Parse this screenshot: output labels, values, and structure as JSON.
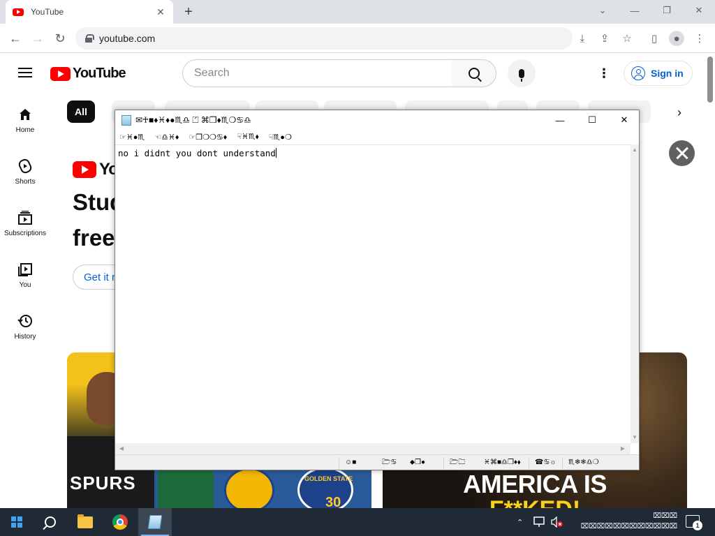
{
  "browser": {
    "tab_title": "YouTube",
    "tab_close": "✕",
    "new_tab": "+",
    "url": "youtube.com",
    "window_controls": [
      "⌄",
      "—",
      "❐",
      "✕"
    ]
  },
  "youtube": {
    "logo_text": "YouTube",
    "search_placeholder": "Search",
    "sign_in": "Sign in",
    "guide": [
      {
        "label": "Home",
        "icon": "home-icon"
      },
      {
        "label": "Shorts",
        "icon": "shorts-icon"
      },
      {
        "label": "Subscriptions",
        "icon": "subscriptions-icon"
      },
      {
        "label": "You",
        "icon": "you-icon"
      },
      {
        "label": "History",
        "icon": "history-icon"
      }
    ],
    "chips": [
      {
        "label": "All",
        "active": true
      },
      {
        "label": ""
      },
      {
        "label": ""
      },
      {
        "label": ""
      },
      {
        "label": ""
      },
      {
        "label": ""
      },
      {
        "label": ""
      },
      {
        "label": ""
      },
      {
        "label": ""
      }
    ],
    "promo": {
      "logo_text": "Yo",
      "line1": "Stud",
      "line2": "free",
      "button": "Get it n"
    },
    "thumb1": {
      "team_text": "SPURS",
      "badge_text": "GOLDEN STATE",
      "badge_number": "30"
    },
    "thumb2": {
      "headline": "AMERICA IS",
      "headline2": "F**KED!"
    }
  },
  "notepad": {
    "title": "✉♰■♦♓♦●♏♎  ⏍  ⌘❒♦♏❍♋♎",
    "menu": [
      "☞♓●♏",
      "☜♎♓♦",
      "☞❒❍❍♋♦",
      "☟♓♏⬧",
      "☟♏●❍"
    ],
    "content": "no i didnt you dont understand",
    "status": [
      "☺■",
      "🗁♋",
      "⬥❒●",
      "🗁🗀",
      "♓⌘■♎❒♦⬧",
      "☎♋☼",
      "♏❄❄♎❍"
    ],
    "controls": [
      "—",
      "☐",
      "✕"
    ]
  },
  "taskbar": {
    "tray_line1": "⌧⌧⌧",
    "tray_line2": "⌧⌧⌧⌧⌧⌧⌧⌧⌧⌧⌧⌧",
    "notifications_count": "1"
  }
}
